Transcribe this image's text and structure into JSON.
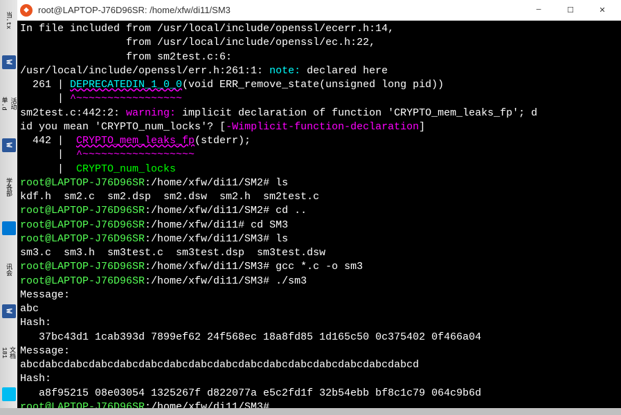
{
  "titlebar": {
    "title": "root@LAPTOP-J76D96SR: /home/xfw/di11/SM3"
  },
  "taskbar": {
    "label1": "当.tx",
    "label2": "活动",
    "label3": "单.d",
    "label4": "学各部",
    "label5": "讯会",
    "label6": "文档",
    "label7": "181"
  },
  "term": {
    "l1a": "In file included from /usr/local/include/openssl/ecerr.h:14,",
    "l2a": "                 from /usr/local/include/openssl/ec.h:22,",
    "l3a": "                 from sm2test.c:6:",
    "l4a": "/usr/local/include/openssl/err.h:261:1: ",
    "l4b": "note: ",
    "l4c": "declared here",
    "l5a": "  261 | ",
    "l5b": "DEPRECATEDIN_1_0_0",
    "l5c": "(void ERR_remove_state(unsigned long pid))",
    "l6a": "      | ",
    "l6b": "^~~~~~~~~~~~~~~~~~",
    "l7a": "sm2test.c:442:2: ",
    "l7b": "warning: ",
    "l7c": "implicit declaration of function '",
    "l7d": "CRYPTO_mem_leaks_fp",
    "l7e": "'; d",
    "l8a": "id you mean '",
    "l8b": "CRYPTO_num_locks",
    "l8c": "'? [",
    "l8d": "-Wimplicit-function-declaration",
    "l8e": "]",
    "l9a": "  442 |  ",
    "l9b": "CRYPTO_mem_leaks_fp",
    "l9c": "(stderr);",
    "l10a": "      |  ",
    "l10b": "^~~~~~~~~~~~~~~~~~~",
    "l11a": "      |  ",
    "l11b": "CRYPTO_num_locks",
    "p1": "root@LAPTOP-J76D96SR",
    "p1path": ":/home/xfw/di11/SM2",
    "p1cmd": "# ls",
    "l13": "kdf.h  sm2.c  sm2.dsp  sm2.dsw  sm2.h  sm2test.c",
    "p2cmd": "# cd ..",
    "p3path": ":/home/xfw/di11",
    "p3cmd": "# cd SM3",
    "p4path": ":/home/xfw/di11/SM3",
    "p4cmd": "# ls",
    "l17": "sm3.c  sm3.h  sm3test.c  sm3test.dsp  sm3test.dsw",
    "p5cmd": "# gcc *.c -o sm3",
    "p6cmd": "# ./sm3",
    "l20": "Message:",
    "l21": "abc",
    "l22": "Hash:",
    "l23": "   37bc43d1 1cab393d 7899ef62 24f568ec 18a8fd85 1d165c50 0c375402 0f466a04",
    "l24": "Message:",
    "l25": "abcdabcdabcdabcdabcdabcdabcdabcdabcdabcdabcdabcdabcdabcdabcdabcd",
    "l26": "Hash:",
    "l27": "   a8f95215 08e03054 1325267f d822077a e5c2fd1f 32b54ebb bf8c1c79 064c9b6d",
    "p7cmd": "# "
  }
}
